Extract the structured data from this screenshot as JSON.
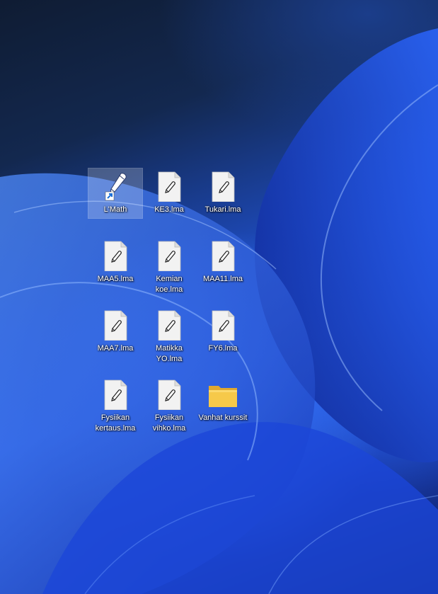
{
  "desktop": {
    "icons": [
      {
        "label": "L'Math",
        "icon": "lmath-app-icon",
        "kind": "shortcut",
        "selected": true
      },
      {
        "label": "KE3.lma",
        "icon": "lma-file-icon",
        "kind": "file"
      },
      {
        "label": "Tukari.lma",
        "icon": "lma-file-icon",
        "kind": "file"
      },
      {
        "label": "MAA5.lma",
        "icon": "lma-file-icon",
        "kind": "file"
      },
      {
        "label": "Kemian koe.lma",
        "icon": "lma-file-icon",
        "kind": "file"
      },
      {
        "label": "MAA11.lma",
        "icon": "lma-file-icon",
        "kind": "file"
      },
      {
        "label": "MAA7.lma",
        "icon": "lma-file-icon",
        "kind": "file"
      },
      {
        "label": "Matikka YO.lma",
        "icon": "lma-file-icon",
        "kind": "file"
      },
      {
        "label": "FY6.lma",
        "icon": "lma-file-icon",
        "kind": "file"
      },
      {
        "label": "Fysiikan kertaus.lma",
        "icon": "lma-file-icon",
        "kind": "file"
      },
      {
        "label": "Fysiikan vihko.lma",
        "icon": "lma-file-icon",
        "kind": "file"
      },
      {
        "label": "Vanhat kurssit",
        "icon": "folder-icon",
        "kind": "folder"
      }
    ]
  },
  "colors": {
    "folder": "#f6c94a",
    "file_page": "#f2f2f2",
    "selection": "#ffffff"
  }
}
